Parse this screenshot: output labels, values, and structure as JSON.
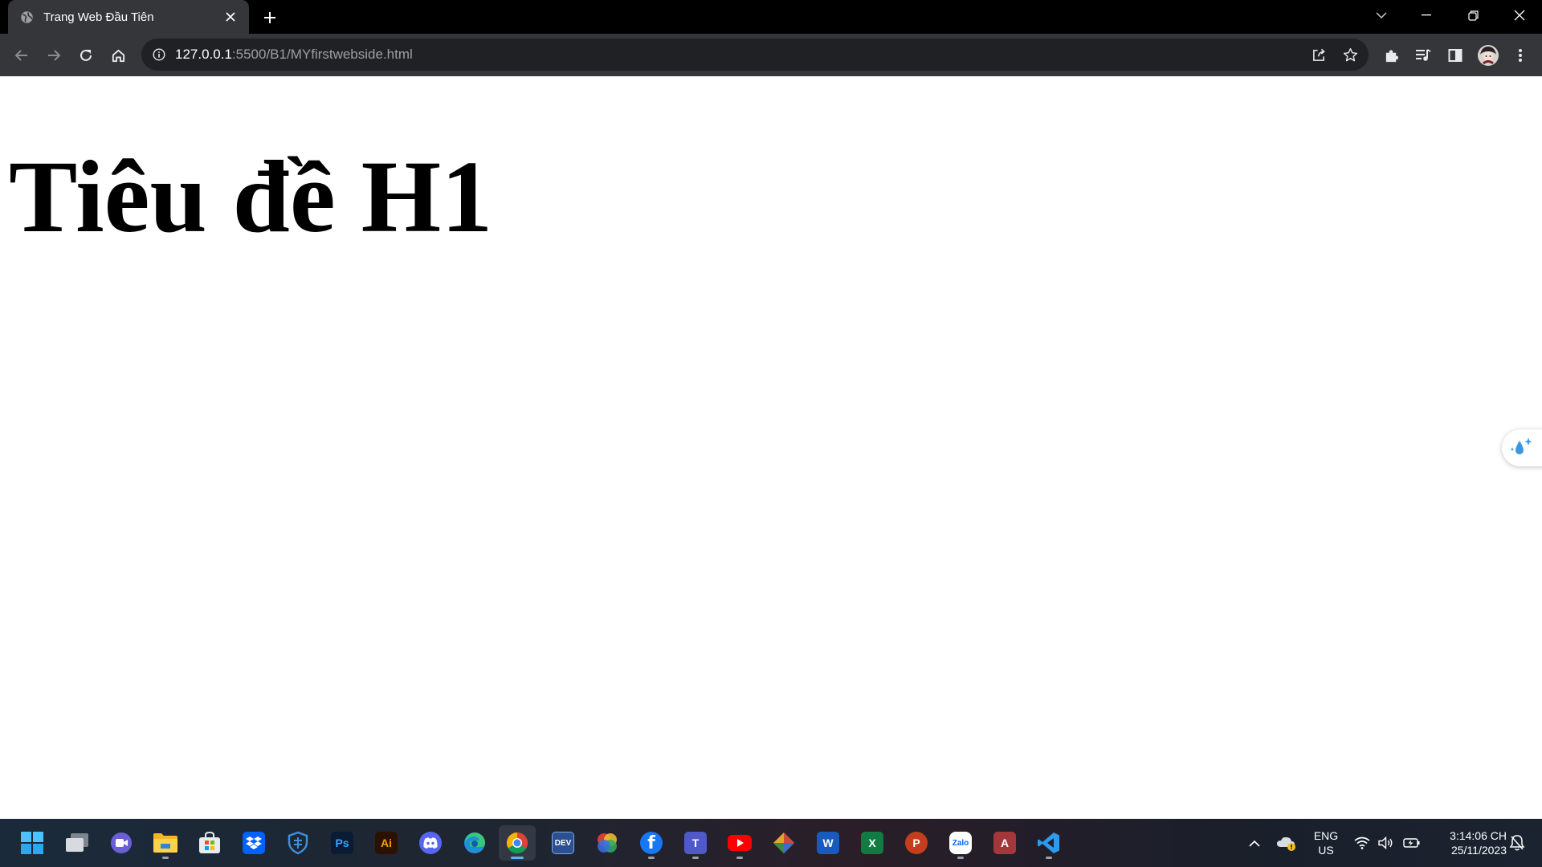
{
  "browser": {
    "tab": {
      "title": "Trang Web Đầu Tiên",
      "favicon": "globe-icon"
    },
    "address": {
      "host": "127.0.0.1",
      "path": ":5500/B1/MYfirstwebside.html"
    }
  },
  "page": {
    "h1": "Tiêu đề H1",
    "side_widget_icon": "water-drop-sparkle-icon"
  },
  "taskbar": {
    "apps": [
      {
        "name": "start",
        "icon": "windows-logo-icon"
      },
      {
        "name": "task-view",
        "icon": "task-view-icon"
      },
      {
        "name": "chat",
        "icon": "camera-chat-icon"
      },
      {
        "name": "file-explorer",
        "icon": "folder-icon"
      },
      {
        "name": "microsoft-store",
        "icon": "store-bag-icon"
      },
      {
        "name": "dropbox",
        "icon": "dropbox-icon"
      },
      {
        "name": "shield-app",
        "icon": "shield-icon"
      },
      {
        "name": "photoshop",
        "label": "Ps"
      },
      {
        "name": "illustrator",
        "label": "Ai"
      },
      {
        "name": "discord",
        "icon": "discord-icon"
      },
      {
        "name": "edge",
        "icon": "edge-icon"
      },
      {
        "name": "chrome",
        "icon": "chrome-icon"
      },
      {
        "name": "dev-c",
        "label": "DEV"
      },
      {
        "name": "color-wheel",
        "icon": "color-wheel-icon"
      },
      {
        "name": "facebook",
        "label": "f"
      },
      {
        "name": "teams",
        "label": "T"
      },
      {
        "name": "youtube",
        "icon": "youtube-icon"
      },
      {
        "name": "diamond-app",
        "icon": "diamond-icon"
      },
      {
        "name": "word",
        "label": "W"
      },
      {
        "name": "excel",
        "label": "X"
      },
      {
        "name": "powerpoint",
        "label": "P"
      },
      {
        "name": "zalo",
        "label": "Zalo"
      },
      {
        "name": "access",
        "label": "A"
      },
      {
        "name": "vscode",
        "icon": "vscode-icon"
      }
    ],
    "tray": {
      "language_line1": "ENG",
      "language_line2": "US",
      "time": "3:14:06 CH",
      "date": "25/11/2023"
    }
  },
  "colors": {
    "tab_active": "#35363a",
    "toolbar": "#35363a",
    "omnibox": "#202124",
    "url_host": "#ffffff",
    "url_path": "#9aa0a6",
    "accent_blue": "#5fb2f0"
  }
}
